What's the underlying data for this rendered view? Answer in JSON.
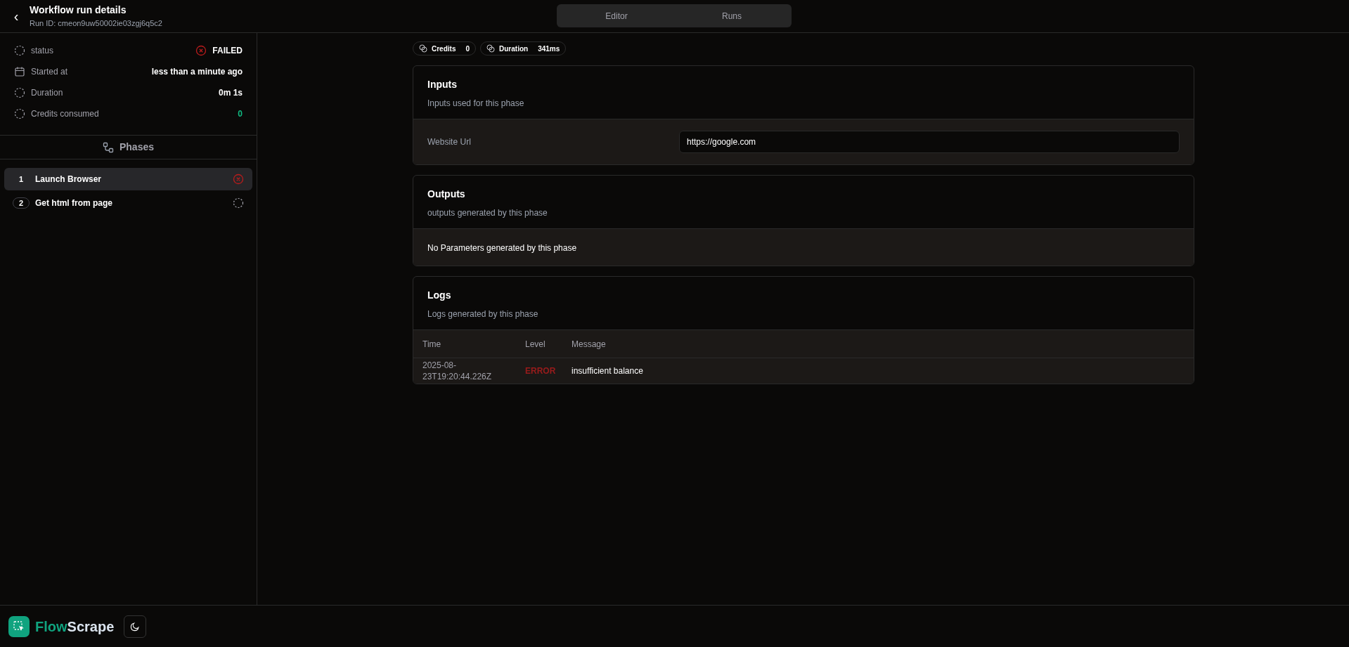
{
  "header": {
    "back": "‹",
    "title": "Workflow run details",
    "subtitle": "Run ID: cmeon9uw50002ie03zgj6q5c2"
  },
  "tabs": [
    {
      "label": "Editor",
      "selected": false
    },
    {
      "label": "Runs",
      "selected": false
    }
  ],
  "run_info": [
    {
      "kind": "status",
      "label": "status",
      "value": "FAILED"
    },
    {
      "kind": "date",
      "label": "Started at",
      "value": "less than a minute ago"
    },
    {
      "kind": "duration",
      "label": "Duration",
      "value": "0m 1s"
    },
    {
      "kind": "credits",
      "label": "Credits consumed",
      "value": "0"
    }
  ],
  "phases": {
    "title": "Phases",
    "items": [
      {
        "number": "1",
        "name": "Launch Browser",
        "selected": true,
        "kind": "failed"
      },
      {
        "number": "2",
        "name": "Get html from page",
        "selected": false,
        "kind": "pending"
      }
    ]
  },
  "badges": [
    {
      "label": "Credits",
      "value": "0"
    },
    {
      "label": "Duration",
      "value": "341ms"
    }
  ],
  "inputs": {
    "title": "Inputs",
    "subtitle": "Inputs used for this phase",
    "fields": [
      {
        "label": "Website Url",
        "value": "https://google.com"
      }
    ]
  },
  "outputs": {
    "title": "Outputs",
    "subtitle": "outputs generated by this phase",
    "empty": "No Parameters generated by this phase"
  },
  "logs": {
    "title": "Logs",
    "subtitle": "Logs generated by this phase",
    "columns": [
      "Time",
      "Level",
      "Message"
    ],
    "rows": [
      {
        "time": "2025-08-23T19:20:44.226Z",
        "level": "ERROR",
        "kind": "error",
        "message": "insufficient balance"
      }
    ]
  },
  "footer": {
    "brand_first": "Flow",
    "brand_second": "Scrape"
  }
}
